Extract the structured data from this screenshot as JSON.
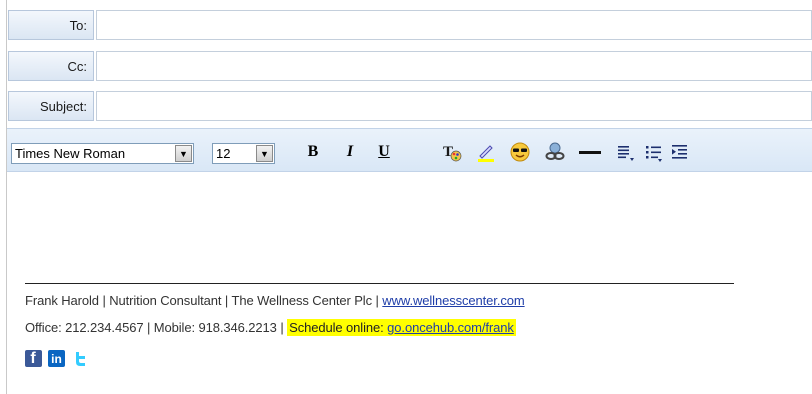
{
  "header": {
    "to_label": "To:",
    "cc_label": "Cc:",
    "subject_label": "Subject:",
    "to_value": "",
    "cc_value": "",
    "subject_value": ""
  },
  "toolbar": {
    "font_family": "Times New Roman",
    "font_size": "12",
    "bold_label": "B",
    "italic_label": "I",
    "underline_label": "U",
    "icons": [
      "text-color-icon",
      "highlight-icon",
      "emoticon-icon",
      "link-icon",
      "horizontal-rule-icon",
      "align-icon",
      "list-icon",
      "indent-icon"
    ]
  },
  "signature": {
    "line1_text": "Frank Harold | Nutrition Consultant | The Wellness Center Plc | ",
    "line1_link": "www.wellnesscenter.com",
    "line2_text": "Office: 212.234.4567 | Mobile: 918.346.2213 | ",
    "schedule_label": "Schedule online: ",
    "schedule_link": "go.oncehub.com/frank",
    "social": [
      "facebook-icon",
      "linkedin-icon",
      "twitter-icon"
    ]
  },
  "colors": {
    "toolbar_bg": "#dde9f7",
    "link": "#1f3ea8",
    "highlight": "#ffff00",
    "facebook": "#3b5998",
    "linkedin": "#0a66c2",
    "twitter": "#33ccff"
  }
}
